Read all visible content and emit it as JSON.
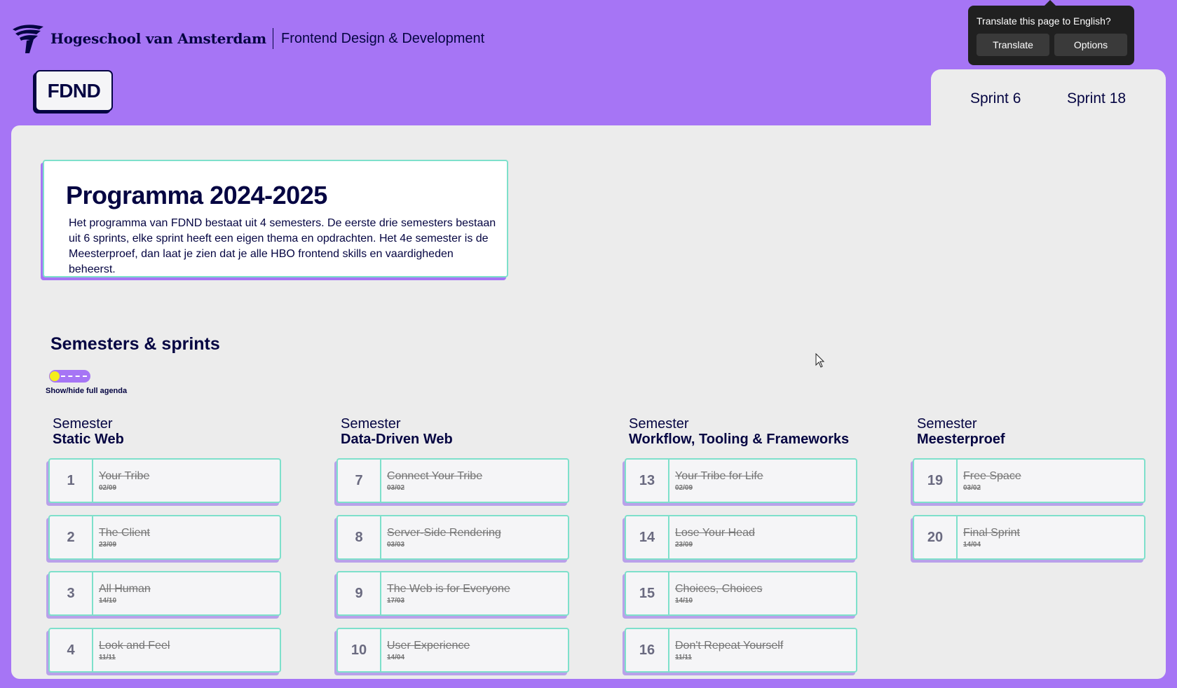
{
  "header": {
    "school_name": "Hogeschool van Amsterdam",
    "program_name": "Frontend Design & Development",
    "fdnd_button": "FDND",
    "nav": [
      {
        "label": "Sprint 6"
      },
      {
        "label": "Sprint 18"
      }
    ]
  },
  "translate_popup": {
    "question": "Translate this page to English?",
    "translate_label": "Translate",
    "options_label": "Options"
  },
  "intro": {
    "title": "Programma 2024-2025",
    "text": "Het programma van FDND bestaat uit 4 semesters. De eerste drie semesters bestaan uit 6 sprints, elke sprint heeft een eigen thema en opdrachten. Het 4e semester is de Meesterproef, dan laat je zien dat je alle HBO frontend skills en vaardigheden beheerst."
  },
  "agenda": {
    "title": "Semesters & sprints",
    "toggle_label": "Show/hide full agenda",
    "semesters": [
      {
        "label": "Semester",
        "name": "Static Web",
        "sprints": [
          {
            "number": "1",
            "title": "Your Tribe",
            "date": "02/09"
          },
          {
            "number": "2",
            "title": "The Client",
            "date": "23/09"
          },
          {
            "number": "3",
            "title": "All Human",
            "date": "14/10"
          },
          {
            "number": "4",
            "title": "Look and Feel",
            "date": "11/11"
          }
        ]
      },
      {
        "label": "Semester",
        "name": "Data-Driven Web",
        "sprints": [
          {
            "number": "7",
            "title": "Connect Your Tribe",
            "date": "03/02"
          },
          {
            "number": "8",
            "title": "Server-Side Rendering",
            "date": "03/03"
          },
          {
            "number": "9",
            "title": "The Web is for Everyone",
            "date": "17/03"
          },
          {
            "number": "10",
            "title": "User Experience",
            "date": "14/04"
          }
        ]
      },
      {
        "label": "Semester",
        "name": "Workflow, Tooling & Frameworks",
        "sprints": [
          {
            "number": "13",
            "title": "Your Tribe for Life",
            "date": "02/09"
          },
          {
            "number": "14",
            "title": "Lose Your Head",
            "date": "23/09"
          },
          {
            "number": "15",
            "title": "Choices, Choices",
            "date": "14/10"
          },
          {
            "number": "16",
            "title": "Don't Repeat Yourself",
            "date": "11/11"
          }
        ]
      },
      {
        "label": "Semester",
        "name": "Meesterproef",
        "sprints": [
          {
            "number": "19",
            "title": "Free Space",
            "date": "03/02"
          },
          {
            "number": "20",
            "title": "Final Sprint",
            "date": "14/04"
          }
        ]
      }
    ]
  },
  "colors": {
    "brand_purple": "#a675f5",
    "navy": "#050542",
    "mint_border": "#7ee0cb",
    "toggle_knob": "#f5ed1b"
  }
}
